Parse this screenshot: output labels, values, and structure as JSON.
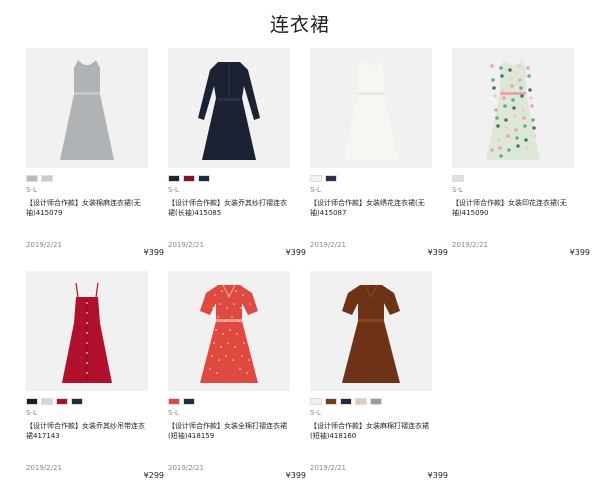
{
  "page": {
    "title": "连衣裙"
  },
  "products": [
    {
      "swatches": [
        "#b8bbb9",
        "#c8cccf"
      ],
      "size": "S-L",
      "name": "【设计师合作款】女装棉麻连衣裙(无袖)415079",
      "date": "2019/2/21",
      "price": "¥399",
      "dress": {
        "type": "sleeveless",
        "color": "#b0b3b5",
        "accent": "#c4c7c8"
      }
    },
    {
      "swatches": [
        "#1f2535",
        "#8a1027",
        "#1b2a44"
      ],
      "size": "S-L",
      "name": "【设计师合作款】女装乔其纱打褶连衣裙(长袖)415085",
      "date": "2019/2/21",
      "price": "¥399",
      "dress": {
        "type": "long-sleeve",
        "color": "#1c2233",
        "accent": "#2a3145"
      }
    },
    {
      "swatches": [
        "#f3f1ea",
        "#2a3346"
      ],
      "size": "S-L",
      "name": "【设计师合作款】女装绣花连衣裙(无袖)415087",
      "date": "2019/2/21",
      "price": "¥399",
      "dress": {
        "type": "sleeveless",
        "color": "#f7f6f1",
        "accent": "#e9e7df"
      }
    },
    {
      "swatches": [
        "#d9e2dc"
      ],
      "size": "S-L",
      "name": "【设计师合作款】女装印花连衣裙(无袖)415090",
      "date": "2019/2/21",
      "price": "¥399",
      "dress": {
        "type": "sleeveless-floral",
        "color": "#dde8d8",
        "accent": "#e8a6b4"
      }
    },
    {
      "swatches": [
        "#1d1d22",
        "#d6d7da",
        "#a3132c",
        "#1e2a40"
      ],
      "size": "S-L",
      "name": "【设计师合作款】女装乔其纱吊带连衣裙417143",
      "date": "2019/2/21",
      "price": "¥299",
      "dress": {
        "type": "strap",
        "color": "#b0102c",
        "accent": "#8e0c22"
      }
    },
    {
      "swatches": [
        "#d8493f",
        "#1f2a44"
      ],
      "size": "S-L",
      "name": "【设计师合作款】女装全棉打褶连衣裙(短袖)418159",
      "date": "2019/2/21",
      "price": "¥399",
      "dress": {
        "type": "short-sleeve",
        "color": "#de4a40",
        "accent": "#f29a8e"
      }
    },
    {
      "swatches": [
        "#efefef",
        "#7a3d1c",
        "#1f2a44",
        "#e2c9bd",
        "#9a9b9e"
      ],
      "size": "S-L",
      "name": "【设计师合作款】女装麻棉打褶连衣裙(短袖)418160",
      "date": "2019/2/21",
      "price": "¥399",
      "dress": {
        "type": "short-sleeve",
        "color": "#6e3316",
        "accent": "#8a4520"
      }
    }
  ]
}
